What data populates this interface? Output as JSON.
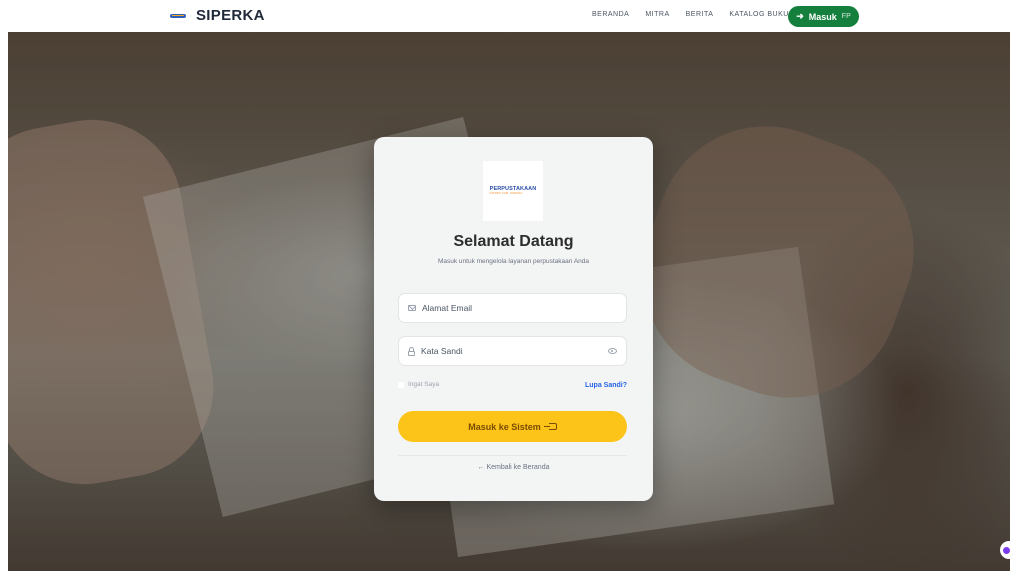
{
  "nav": {
    "brand": "SIPERKA",
    "links": [
      "BERANDA",
      "MITRA",
      "BERITA"
    ],
    "catalog_label": "KATALOG BUKU",
    "login_label": "Masuk",
    "login_suffix": "FP"
  },
  "login": {
    "logo_text": "PERPUSTAKAAN",
    "logo_subtext": "DISTRIK KAB. SORONG",
    "title": "Selamat Datang",
    "subtitle": "Masuk untuk mengelola layanan perpustakaan Anda",
    "email_placeholder": "Alamat Email",
    "password_placeholder": "Kata Sandi",
    "remember_label": "Ingat Saya",
    "forgot_label": "Lupa Sandi?",
    "submit_label": "Masuk ke Sistem",
    "back_label": "← Kembali ke Beranda"
  },
  "colors": {
    "nav_login_bg": "#15803d",
    "submit_bg": "#fcc419",
    "link": "#2563eb"
  }
}
